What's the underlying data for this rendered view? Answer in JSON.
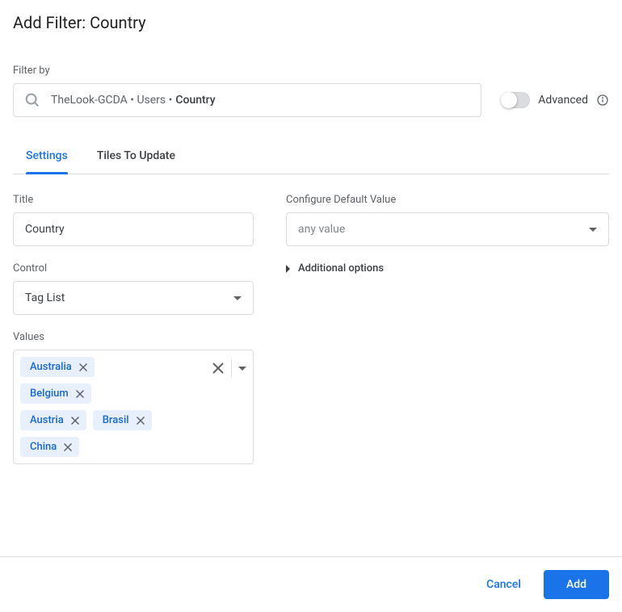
{
  "header": {
    "title": "Add Filter: Country"
  },
  "filter_by": {
    "label": "Filter by",
    "path_prefix": "TheLook-GCDA • Users • ",
    "path_bold": "Country",
    "advanced_label": "Advanced"
  },
  "tabs": {
    "settings": "Settings",
    "tiles": "Tiles To Update"
  },
  "left": {
    "title_label": "Title",
    "title_value": "Country",
    "control_label": "Control",
    "control_value": "Tag List",
    "values_label": "Values",
    "tags": [
      "Australia",
      "Belgium",
      "Austria",
      "Brasil",
      "China"
    ]
  },
  "right": {
    "default_label": "Configure Default Value",
    "default_value": "any value",
    "additional": "Additional options"
  },
  "footer": {
    "cancel": "Cancel",
    "add": "Add"
  }
}
